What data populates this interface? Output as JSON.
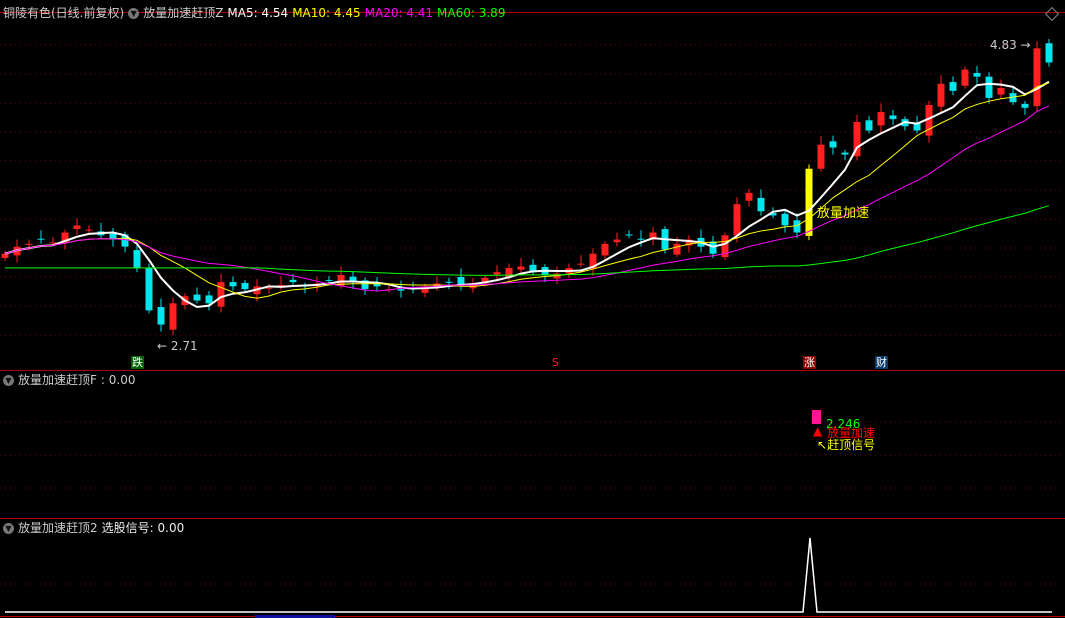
{
  "main_panel": {
    "stock_title": "铜陵有色(日线.前复权)",
    "indicator_name": "放量加速赶顶Z",
    "ma": [
      {
        "label": "MA5: 4.54",
        "color": "#ffffff"
      },
      {
        "label": "MA10: 4.45",
        "color": "#ffff00"
      },
      {
        "label": "MA20: 4.41",
        "color": "#ff00ff"
      },
      {
        "label": "MA60: 3.89",
        "color": "#00ff00"
      }
    ],
    "high_label": "4.83",
    "low_label": "2.71",
    "annotation": "放量加速",
    "signals": [
      {
        "text": "跌",
        "index": 11,
        "bg": "#006400",
        "color": "#ffffff"
      },
      {
        "text": "S",
        "index": 46,
        "bg": "transparent",
        "color": "#ff2020"
      },
      {
        "text": "涨",
        "index": 67,
        "bg": "#8b0000",
        "color": "#ffffff"
      },
      {
        "text": "财",
        "index": 73,
        "bg": "#0a3a6a",
        "color": "#ffffff"
      }
    ]
  },
  "panel2": {
    "title": "放量加速赶顶F",
    "value": ": 0.00",
    "value_label": "2.246",
    "signal1": "放量加速",
    "signal2": "赶顶信号"
  },
  "panel3": {
    "title": "放量加速赶顶2",
    "value": "选股信号: 0.00"
  },
  "chart_data": {
    "type": "candlestick",
    "close": [
      3.35,
      3.4,
      3.42,
      3.45,
      3.43,
      3.5,
      3.55,
      3.52,
      3.48,
      3.45,
      3.4,
      3.25,
      2.95,
      2.85,
      3.0,
      3.05,
      3.02,
      3.0,
      3.15,
      3.12,
      3.1,
      3.12,
      3.11,
      3.13,
      3.15,
      3.12,
      3.14,
      3.16,
      3.2,
      3.15,
      3.1,
      3.12,
      3.1,
      3.09,
      3.11,
      3.12,
      3.14,
      3.15,
      3.13,
      3.14,
      3.18,
      3.22,
      3.25,
      3.26,
      3.22,
      3.2,
      3.21,
      3.25,
      3.28,
      3.35,
      3.42,
      3.45,
      3.48,
      3.45,
      3.5,
      3.38,
      3.42,
      3.45,
      3.4,
      3.35,
      3.48,
      3.7,
      3.78,
      3.65,
      3.62,
      3.55,
      3.5,
      3.95,
      4.12,
      4.1,
      4.05,
      4.28,
      4.22,
      4.35,
      4.3,
      4.25,
      4.22,
      4.4,
      4.55,
      4.5,
      4.65,
      4.6,
      4.45,
      4.52,
      4.42,
      4.38,
      4.8,
      4.7
    ],
    "ylim": [
      2.6,
      5.0
    ],
    "signal_series": {
      "spike_index": 67,
      "value": 1
    }
  },
  "colors": {
    "up": "#ff2020",
    "down": "#00e5ee",
    "ma5": "#ffffff",
    "ma10": "#ffff00",
    "ma20": "#ff00ff",
    "ma60": "#00ff00",
    "separator": "#b00000"
  }
}
